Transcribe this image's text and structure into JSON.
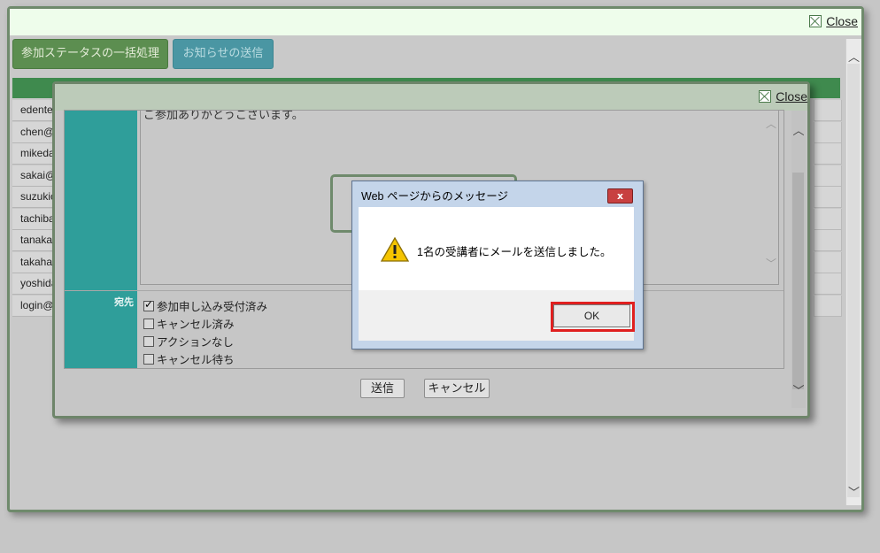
{
  "outer": {
    "close_label": "Close",
    "bulk_status_button": "参加ステータスの一括処理",
    "send_notice_button": "お知らせの送信",
    "emails": [
      "edente",
      "chen@",
      "mikeda",
      "sakai@",
      "suzukic",
      "tachiba",
      "tanaka",
      "takaha",
      "yoshida",
      "login@"
    ]
  },
  "inner": {
    "close_label": "Close",
    "message_text": "ご参加ありがとうございます。",
    "recipients_label": "宛先",
    "checkboxes": [
      {
        "label": "参加申し込み受付済み",
        "checked": true
      },
      {
        "label": "キャンセル済み",
        "checked": false
      },
      {
        "label": "アクションなし",
        "checked": false
      },
      {
        "label": "キャンセル待ち",
        "checked": false
      }
    ],
    "send_button": "送信",
    "cancel_button": "キャンセル"
  },
  "message_box": {
    "title": "Web ページからのメッセージ",
    "close_glyph": "x",
    "text": "1名の受講者にメールを送信しました。",
    "ok_button": "OK",
    "icon": "warning-icon"
  },
  "colors": {
    "teal": "#2f9e9a",
    "green_button": "#5c8e50",
    "highlight": "#e02020"
  }
}
